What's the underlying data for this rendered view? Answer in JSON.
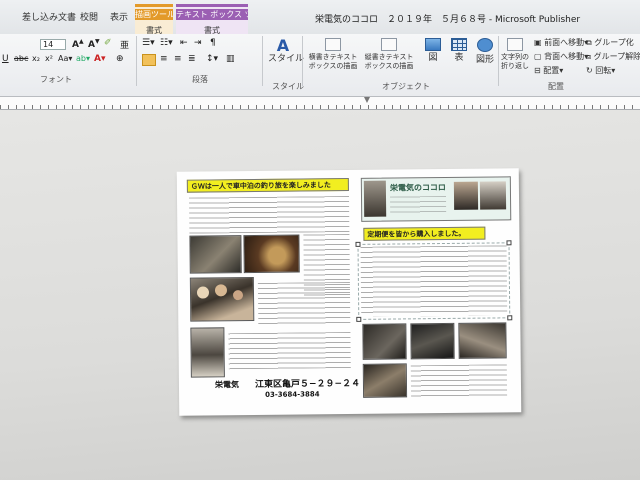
{
  "window": {
    "title": "栄電気のココロ　２０１９年　５月６８号 - Microsoft Publisher"
  },
  "tabs": {
    "mailings": "差し込み文書",
    "review": "校閲",
    "view": "表示",
    "drawing_tools": {
      "caption": "描画ツール",
      "tab": "書式"
    },
    "textbox_tools": {
      "caption": "テキスト ボックス ツール",
      "tab": "書式"
    }
  },
  "ribbon": {
    "font_size": "14",
    "groups": {
      "font": "フォント",
      "paragraph": "段落",
      "styles": "スタイル",
      "objects": "オブジェクト",
      "arrange": "配置"
    },
    "buttons": {
      "styles": "スタイル",
      "draw_text_box": "横書きテキスト ボックスの描画",
      "draw_vertical_text_box": "縦書きテキスト ボックスの描画",
      "picture": "図",
      "table": "表",
      "shapes": "図形",
      "wrap_text": "文字列の折り返し",
      "bring_forward": "前面へ移動",
      "send_backward": "背面へ移動",
      "group": "グループ化",
      "ungroup": "グループ解除",
      "align": "配置",
      "rotate": "回転"
    }
  },
  "newsletter": {
    "left_heading": "ＧＷは一人で車中泊の釣り旅を楽しみました",
    "logo_title": "栄電気のココロ",
    "right_heading": "定期便を皆から購入しました。",
    "shop_name": "栄電気",
    "address": "江東区亀戸５−２９−２４",
    "phone": "03-3684-3884"
  }
}
